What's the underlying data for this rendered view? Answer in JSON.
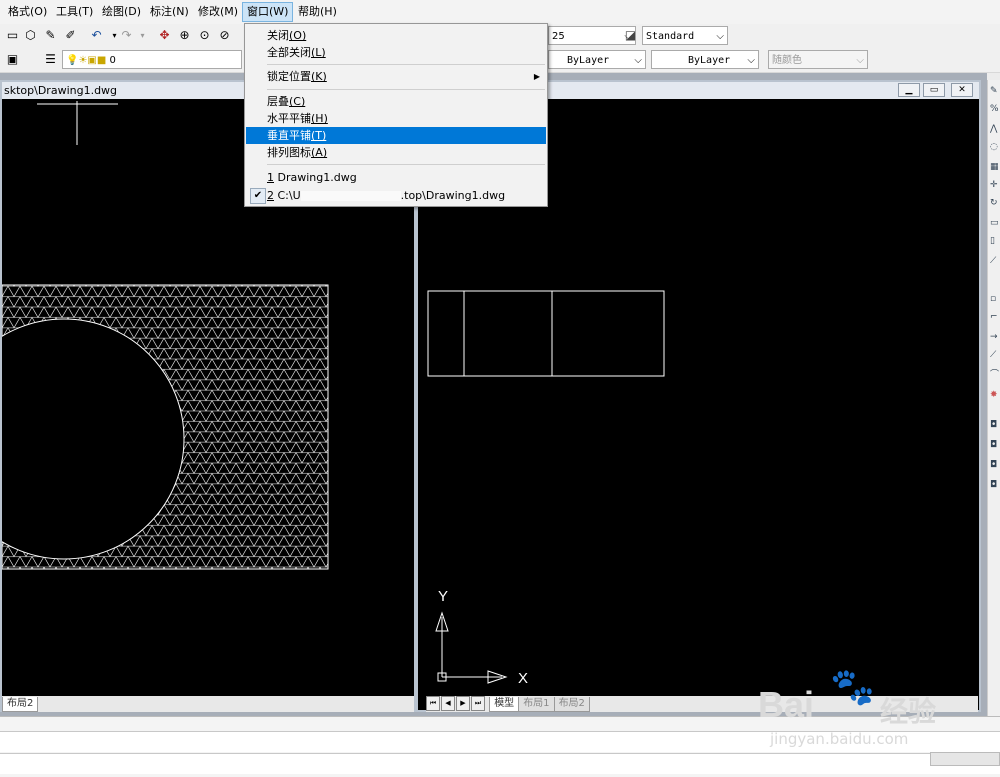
{
  "menubar": {
    "items": [
      "格式(O)",
      "工具(T)",
      "绘图(D)",
      "标注(N)",
      "修改(M)",
      "窗口(W)",
      "帮助(H)"
    ]
  },
  "toolbar1": {
    "linetype_scale": "25",
    "text_style": "Standard"
  },
  "toolbar2": {
    "layer_name": "0",
    "linetype": "ByLayer",
    "lineweight": "ByLayer",
    "plot_style": "随颜色"
  },
  "left_window": {
    "title": "sktop\\Drawing1.dwg",
    "tab": "布局2"
  },
  "right_window": {
    "tabs": [
      "模型",
      "布局1",
      "布局2"
    ]
  },
  "ucs": {
    "x_label": "X",
    "y_label": "Y"
  },
  "window_menu": {
    "items": [
      {
        "label": "关闭",
        "key": "(O)"
      },
      {
        "label": "全部关闭",
        "key": "(L)"
      },
      {
        "label": "锁定位置",
        "key": "(K)",
        "submenu": true
      },
      {
        "label": "层叠",
        "key": "(C)"
      },
      {
        "label": "水平平铺",
        "key": "(H)"
      },
      {
        "label": "垂直平铺",
        "key": "(T)",
        "highlighted": true
      },
      {
        "label": "排列图标",
        "key": "(A)"
      }
    ],
    "recent": [
      {
        "num": "1",
        "label": " Drawing1.dwg"
      },
      {
        "num": "2",
        "label": " C:\\U",
        "tail": ".top\\Drawing1.dwg",
        "checked": true
      }
    ]
  },
  "watermark": {
    "brand": "Bai",
    "brand_cn": "经验",
    "url": "jingyan.baidu.com"
  },
  "colors": {
    "highlight": "#0078d7",
    "canvas": "#000000"
  }
}
